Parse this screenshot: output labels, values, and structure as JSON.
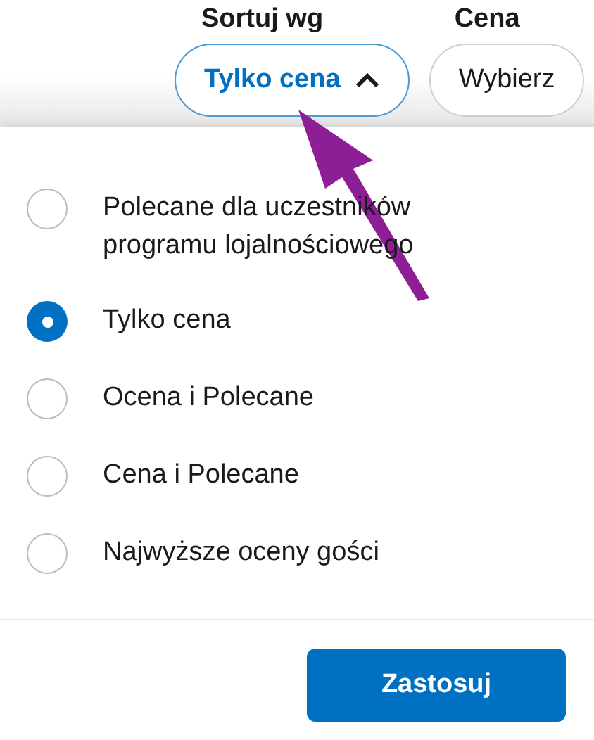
{
  "filters": [
    {
      "label": "Sortuj wg",
      "value": "Tylko cena",
      "expanded": true,
      "active": true
    },
    {
      "label": "Cena",
      "value": "Wybierz",
      "expanded": false,
      "active": false
    }
  ],
  "options": [
    {
      "label": "Polecane dla uczestników programu lojalnościowego",
      "selected": false
    },
    {
      "label": "Tylko cena",
      "selected": true
    },
    {
      "label": "Ocena i Polecane",
      "selected": false
    },
    {
      "label": "Cena i Polecane",
      "selected": false
    },
    {
      "label": "Najwyższe oceny gości",
      "selected": false
    }
  ],
  "apply_button": "Zastosuj"
}
